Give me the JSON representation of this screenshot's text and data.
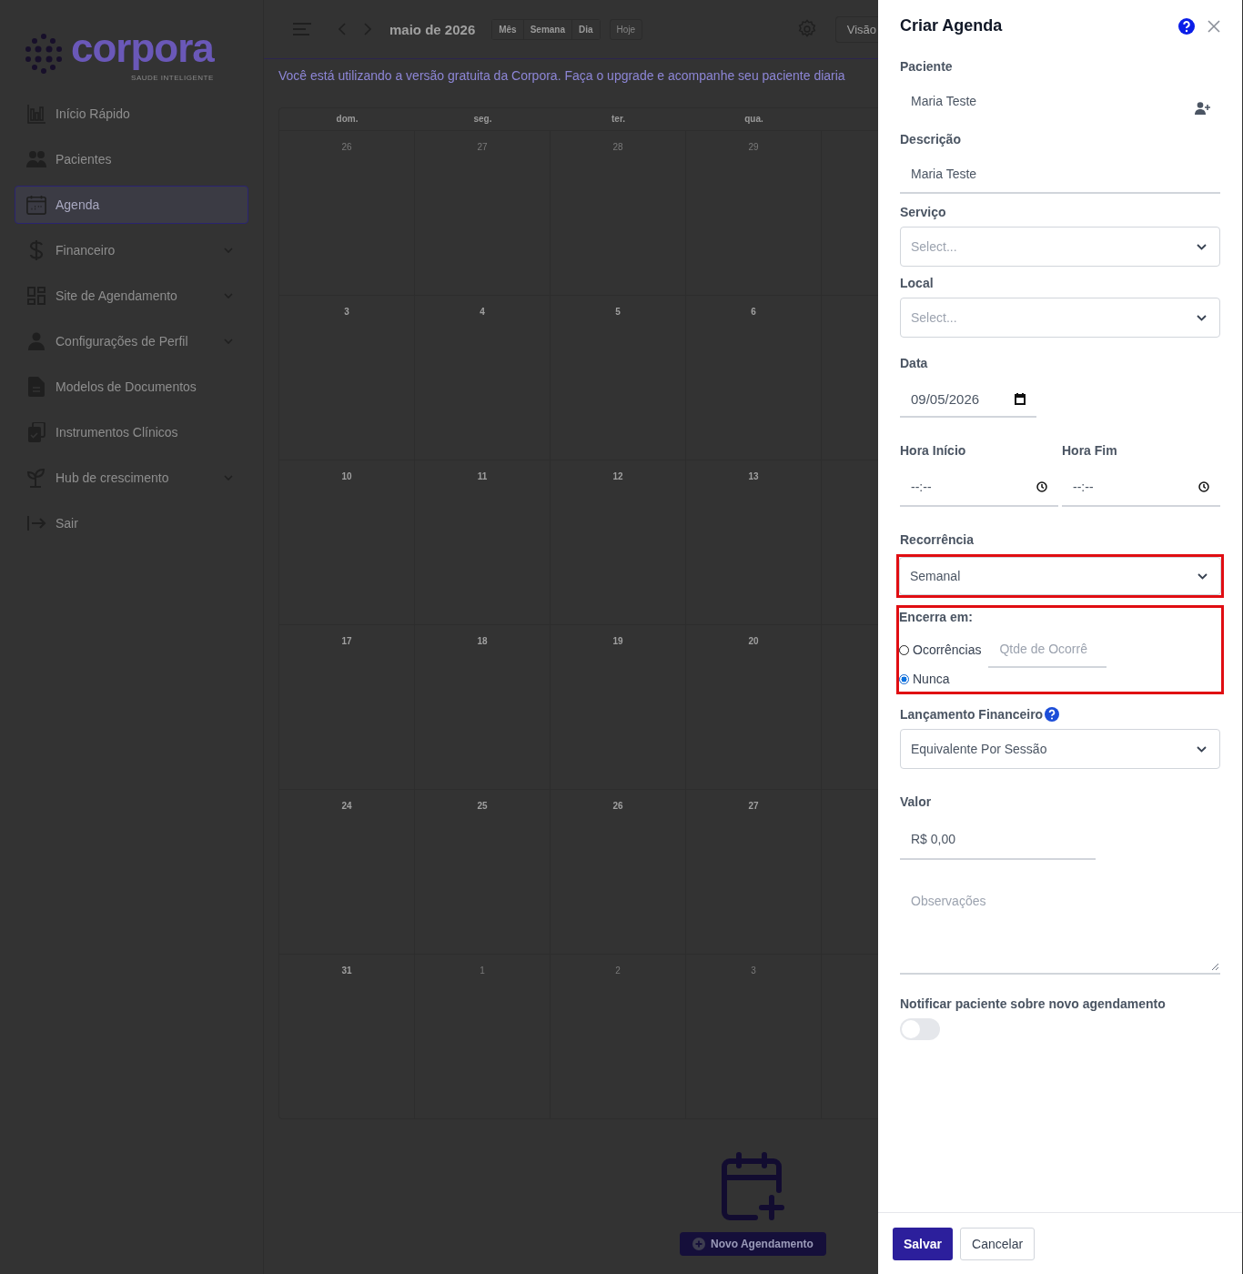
{
  "sidebar": {
    "logo": {
      "name": "corpora",
      "tagline": "SAUDE INTELIGENTE"
    },
    "items": [
      {
        "label": "Início Rápido",
        "selected": false,
        "expandable": false
      },
      {
        "label": "Pacientes",
        "selected": false,
        "expandable": false
      },
      {
        "label": "Agenda",
        "selected": true,
        "expandable": false
      },
      {
        "label": "Financeiro",
        "selected": false,
        "expandable": true
      },
      {
        "label": "Site de Agendamento",
        "selected": false,
        "expandable": true
      },
      {
        "label": "Configurações de Perfil",
        "selected": false,
        "expandable": true
      },
      {
        "label": "Modelos de Documentos",
        "selected": false,
        "expandable": false
      },
      {
        "label": "Instrumentos Clínicos",
        "selected": false,
        "expandable": false
      },
      {
        "label": "Hub de crescimento",
        "selected": false,
        "expandable": true
      },
      {
        "label": "Sair",
        "selected": false,
        "expandable": false
      }
    ]
  },
  "toolbar": {
    "month": "maio de 2026",
    "views": [
      "Mês",
      "Semana",
      "Dia"
    ],
    "today": "Hoje",
    "view_button": "Visão"
  },
  "banner": "Você está utilizando a versão gratuita da Corpora. Faça o upgrade e acompanhe seu paciente diaria",
  "calendar": {
    "weekdays": [
      "dom.",
      "seg.",
      "ter.",
      "qua."
    ],
    "weeks": [
      [
        {
          "day": "26",
          "outside": true
        },
        {
          "day": "27",
          "outside": true
        },
        {
          "day": "28",
          "outside": true
        },
        {
          "day": "29",
          "outside": true
        }
      ],
      [
        {
          "day": "3",
          "outside": false
        },
        {
          "day": "4",
          "outside": false
        },
        {
          "day": "5",
          "outside": false
        },
        {
          "day": "6",
          "outside": false
        }
      ],
      [
        {
          "day": "10",
          "outside": false
        },
        {
          "day": "11",
          "outside": false
        },
        {
          "day": "12",
          "outside": false
        },
        {
          "day": "13",
          "outside": false
        }
      ],
      [
        {
          "day": "17",
          "outside": false
        },
        {
          "day": "18",
          "outside": false
        },
        {
          "day": "19",
          "outside": false
        },
        {
          "day": "20",
          "outside": false
        }
      ],
      [
        {
          "day": "24",
          "outside": false
        },
        {
          "day": "25",
          "outside": false
        },
        {
          "day": "26",
          "outside": false
        },
        {
          "day": "27",
          "outside": false
        }
      ],
      [
        {
          "day": "31",
          "outside": false
        },
        {
          "day": "1",
          "outside": true
        },
        {
          "day": "2",
          "outside": true
        },
        {
          "day": "3",
          "outside": true
        }
      ]
    ]
  },
  "new_appointment": "Novo Agendamento",
  "drawer": {
    "title": "Criar Agenda",
    "patient": {
      "label": "Paciente",
      "value": "Maria Teste"
    },
    "description": {
      "label": "Descrição",
      "value": "Maria Teste"
    },
    "service": {
      "label": "Serviço",
      "placeholder": "Select..."
    },
    "location": {
      "label": "Local",
      "placeholder": "Select..."
    },
    "date": {
      "label": "Data",
      "value": "09/05/2026"
    },
    "start_time": {
      "label": "Hora Início",
      "value": "--:--"
    },
    "end_time": {
      "label": "Hora Fim",
      "value": "--:--"
    },
    "recurrence": {
      "label": "Recorrência",
      "value": "Semanal",
      "highlighted": true
    },
    "ends": {
      "label": "Encerra em:",
      "highlighted": true,
      "options": [
        {
          "label": "Ocorrências",
          "selected": false,
          "kind": "count",
          "placeholder": "Qtde de Ocorrê"
        },
        {
          "label": "Nunca",
          "selected": true,
          "kind": "plain"
        }
      ]
    },
    "financial": {
      "label": "Lançamento Financeiro",
      "value": "Equivalente Por Sessão"
    },
    "amount": {
      "label": "Valor",
      "value": "R$ 0,00"
    },
    "notes": {
      "placeholder": "Observações"
    },
    "notify": {
      "label": "Notificar paciente sobre novo agendamento",
      "on": false
    },
    "buttons": [
      {
        "label": "Salvar",
        "kind": "primary"
      },
      {
        "label": "Cancelar",
        "kind": "secondary"
      }
    ]
  }
}
